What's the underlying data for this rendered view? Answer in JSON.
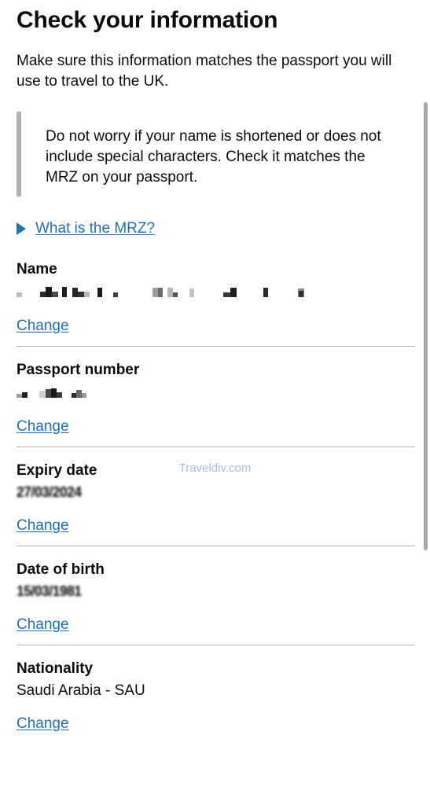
{
  "page": {
    "title": "Check your information",
    "intro": "Make sure this information matches the passport you will use to travel to the UK.",
    "inset_text": "Do not worry if your name is shortened or does not include special characters. Check it matches the MRZ on your passport.",
    "details_summary": "What is the MRZ?"
  },
  "watermark": {
    "text": "Traveldiv.com",
    "color": "#9cc3e8"
  },
  "colors": {
    "link": "#1d70b8",
    "text": "#0b0c0c",
    "border": "#b1b4b6",
    "background": "#ffffff",
    "scrollbar_thumb": "#a8a8a8"
  },
  "summary_list": [
    {
      "key": "Name",
      "value": "",
      "value_state": "redacted-pixelated",
      "action_label": "Change"
    },
    {
      "key": "Passport number",
      "value": "",
      "value_state": "redacted-pixelated",
      "action_label": "Change"
    },
    {
      "key": "Expiry date",
      "value": "27/03/2024",
      "value_state": "blurred",
      "action_label": "Change"
    },
    {
      "key": "Date of birth",
      "value": "15/03/1981",
      "value_state": "blurred",
      "action_label": "Change"
    },
    {
      "key": "Nationality",
      "value": "Saudi Arabia - SAU",
      "value_state": "visible",
      "action_label": "Change"
    }
  ],
  "redaction_blocks": {
    "name": [
      {
        "w": 7,
        "h": 6,
        "c": "#bdbdbd",
        "ml": 0
      },
      {
        "w": 8,
        "h": 7,
        "c": "#ffffff",
        "ml": 15
      },
      {
        "w": 7,
        "h": 7,
        "c": "#2b2b2b",
        "ml": 0
      },
      {
        "w": 8,
        "h": 13,
        "c": "#1a1a1a",
        "ml": 0
      },
      {
        "w": 8,
        "h": 7,
        "c": "#4a4a4a",
        "ml": 0
      },
      {
        "w": 6,
        "h": 13,
        "c": "#1e1e1e",
        "ml": 5
      },
      {
        "w": 7,
        "h": 12,
        "c": "#262626",
        "ml": 7
      },
      {
        "w": 8,
        "h": 7,
        "c": "#303030",
        "ml": 0
      },
      {
        "w": 7,
        "h": 7,
        "c": "#b8b8b8",
        "ml": 0
      },
      {
        "w": 6,
        "h": 12,
        "c": "#1c1c1c",
        "ml": 10
      },
      {
        "w": 6,
        "h": 6,
        "c": "#3d3d3d",
        "ml": 14
      },
      {
        "w": 7,
        "h": 12,
        "c": "#9e9e9e",
        "ml": 44
      },
      {
        "w": 6,
        "h": 12,
        "c": "#6e6e6e",
        "ml": 0
      },
      {
        "w": 7,
        "h": 12,
        "c": "#b5b5b5",
        "ml": 6
      },
      {
        "w": 6,
        "h": 6,
        "c": "#555555",
        "ml": 0
      },
      {
        "w": 6,
        "h": 11,
        "c": "#c2c2c2",
        "ml": 15
      },
      {
        "w": 9,
        "h": 6,
        "c": "#3a3a3a",
        "ml": 37
      },
      {
        "w": 8,
        "h": 12,
        "c": "#1f1f1f",
        "ml": 0
      },
      {
        "w": 6,
        "h": 12,
        "c": "#2a2a2a",
        "ml": 34
      },
      {
        "w": 8,
        "h": 11,
        "c": "#8a8a8a",
        "ml": 38
      },
      {
        "w": 6,
        "h": 8,
        "c": "#2e2e2e",
        "ml": -7
      }
    ],
    "passport": [
      {
        "w": 7,
        "h": 5,
        "c": "#9e9e9e",
        "ml": 0
      },
      {
        "w": 7,
        "h": 7,
        "c": "#1f1f1f",
        "ml": 0
      },
      {
        "w": 8,
        "h": 9,
        "c": "#d0d0d0",
        "ml": 15
      },
      {
        "w": 7,
        "h": 11,
        "c": "#4a4a4a",
        "ml": 0
      },
      {
        "w": 7,
        "h": 12,
        "c": "#1a1a1a",
        "ml": 0
      },
      {
        "w": 7,
        "h": 7,
        "c": "#3c3c3c",
        "ml": 0
      },
      {
        "w": 6,
        "h": 6,
        "c": "#2b2b2b",
        "ml": 12
      },
      {
        "w": 7,
        "h": 10,
        "c": "#6a6a6a",
        "ml": 0
      },
      {
        "w": 6,
        "h": 6,
        "c": "#9a9a9a",
        "ml": 0
      }
    ]
  }
}
